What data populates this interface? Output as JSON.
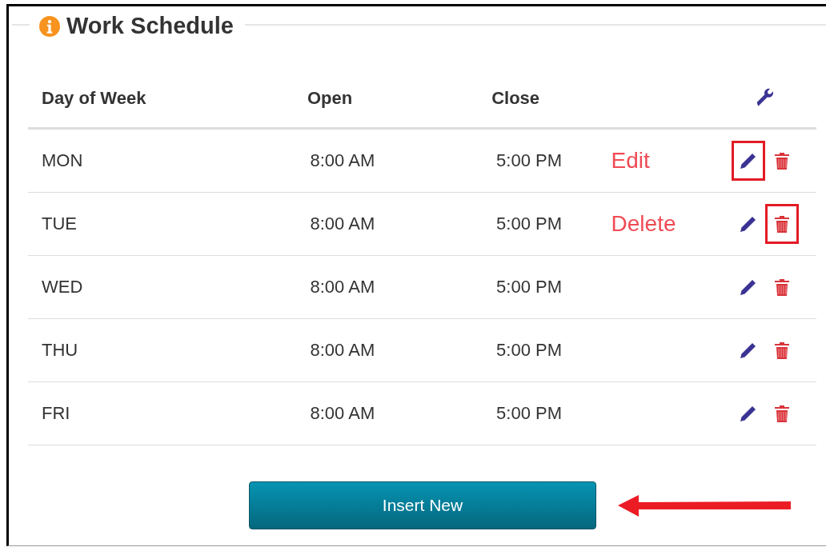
{
  "panel": {
    "title": "Work Schedule"
  },
  "table": {
    "columns": [
      "Day of Week",
      "Open",
      "Close"
    ],
    "rows": [
      {
        "day": "MON",
        "open": "8:00 AM",
        "close": "5:00 PM",
        "callout": "Edit",
        "edit_highlighted": true,
        "delete_highlighted": false
      },
      {
        "day": "TUE",
        "open": "8:00 AM",
        "close": "5:00 PM",
        "callout": "Delete",
        "edit_highlighted": false,
        "delete_highlighted": true
      },
      {
        "day": "WED",
        "open": "8:00 AM",
        "close": "5:00 PM",
        "edit_highlighted": false,
        "delete_highlighted": false
      },
      {
        "day": "THU",
        "open": "8:00 AM",
        "close": "5:00 PM",
        "edit_highlighted": false,
        "delete_highlighted": false
      },
      {
        "day": "FRI",
        "open": "8:00 AM",
        "close": "5:00 PM",
        "edit_highlighted": false,
        "delete_highlighted": false
      }
    ]
  },
  "insert_button": {
    "label": "Insert New"
  }
}
